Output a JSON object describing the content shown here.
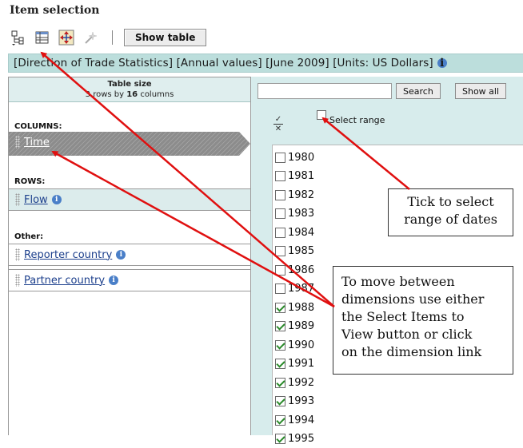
{
  "header": {
    "title": "Item selection"
  },
  "toolbar": {
    "icons": [
      "select-items-icon",
      "table-layout-icon",
      "rotate-icon",
      "wand-icon"
    ],
    "show_table_label": "Show table"
  },
  "breadcrumb": {
    "text": "[Direction of Trade Statistics] [Annual values] [June 2009] [Units: US Dollars]"
  },
  "table_size": {
    "title": "Table size",
    "rows_prefix": "3 rows by ",
    "columns_count": "16",
    "columns_suffix": " columns"
  },
  "dimensions": {
    "columns_label": "COLUMNS:",
    "columns_item": "Time",
    "rows_label": "ROWS:",
    "rows_item": "Flow",
    "other_label": "Other:",
    "other_items": [
      "Reporter country",
      "Partner country"
    ]
  },
  "search": {
    "placeholder": "",
    "search_label": "Search",
    "show_all_label": "Show all",
    "select_range_label": "Select range"
  },
  "years": [
    {
      "label": "1980",
      "checked": false
    },
    {
      "label": "1981",
      "checked": false
    },
    {
      "label": "1982",
      "checked": false
    },
    {
      "label": "1983",
      "checked": false
    },
    {
      "label": "1984",
      "checked": false
    },
    {
      "label": "1985",
      "checked": false
    },
    {
      "label": "1986",
      "checked": false
    },
    {
      "label": "1987",
      "checked": false
    },
    {
      "label": "1988",
      "checked": true
    },
    {
      "label": "1989",
      "checked": true
    },
    {
      "label": "1990",
      "checked": true
    },
    {
      "label": "1991",
      "checked": true
    },
    {
      "label": "1992",
      "checked": true
    },
    {
      "label": "1993",
      "checked": true
    },
    {
      "label": "1994",
      "checked": true
    },
    {
      "label": "1995",
      "checked": true
    }
  ],
  "callouts": {
    "range": [
      "Tick to select",
      "range of dates"
    ],
    "dims": [
      "To move between",
      "dimensions use either",
      "the Select Items to",
      "View button or click",
      "on the dimension link"
    ]
  },
  "colors": {
    "teal_bar": "#bcdedc",
    "right_panel": "#d7ecec",
    "active_tab": "#8c8c8c",
    "link": "#1c3f8c",
    "arrow": "#e01010"
  }
}
